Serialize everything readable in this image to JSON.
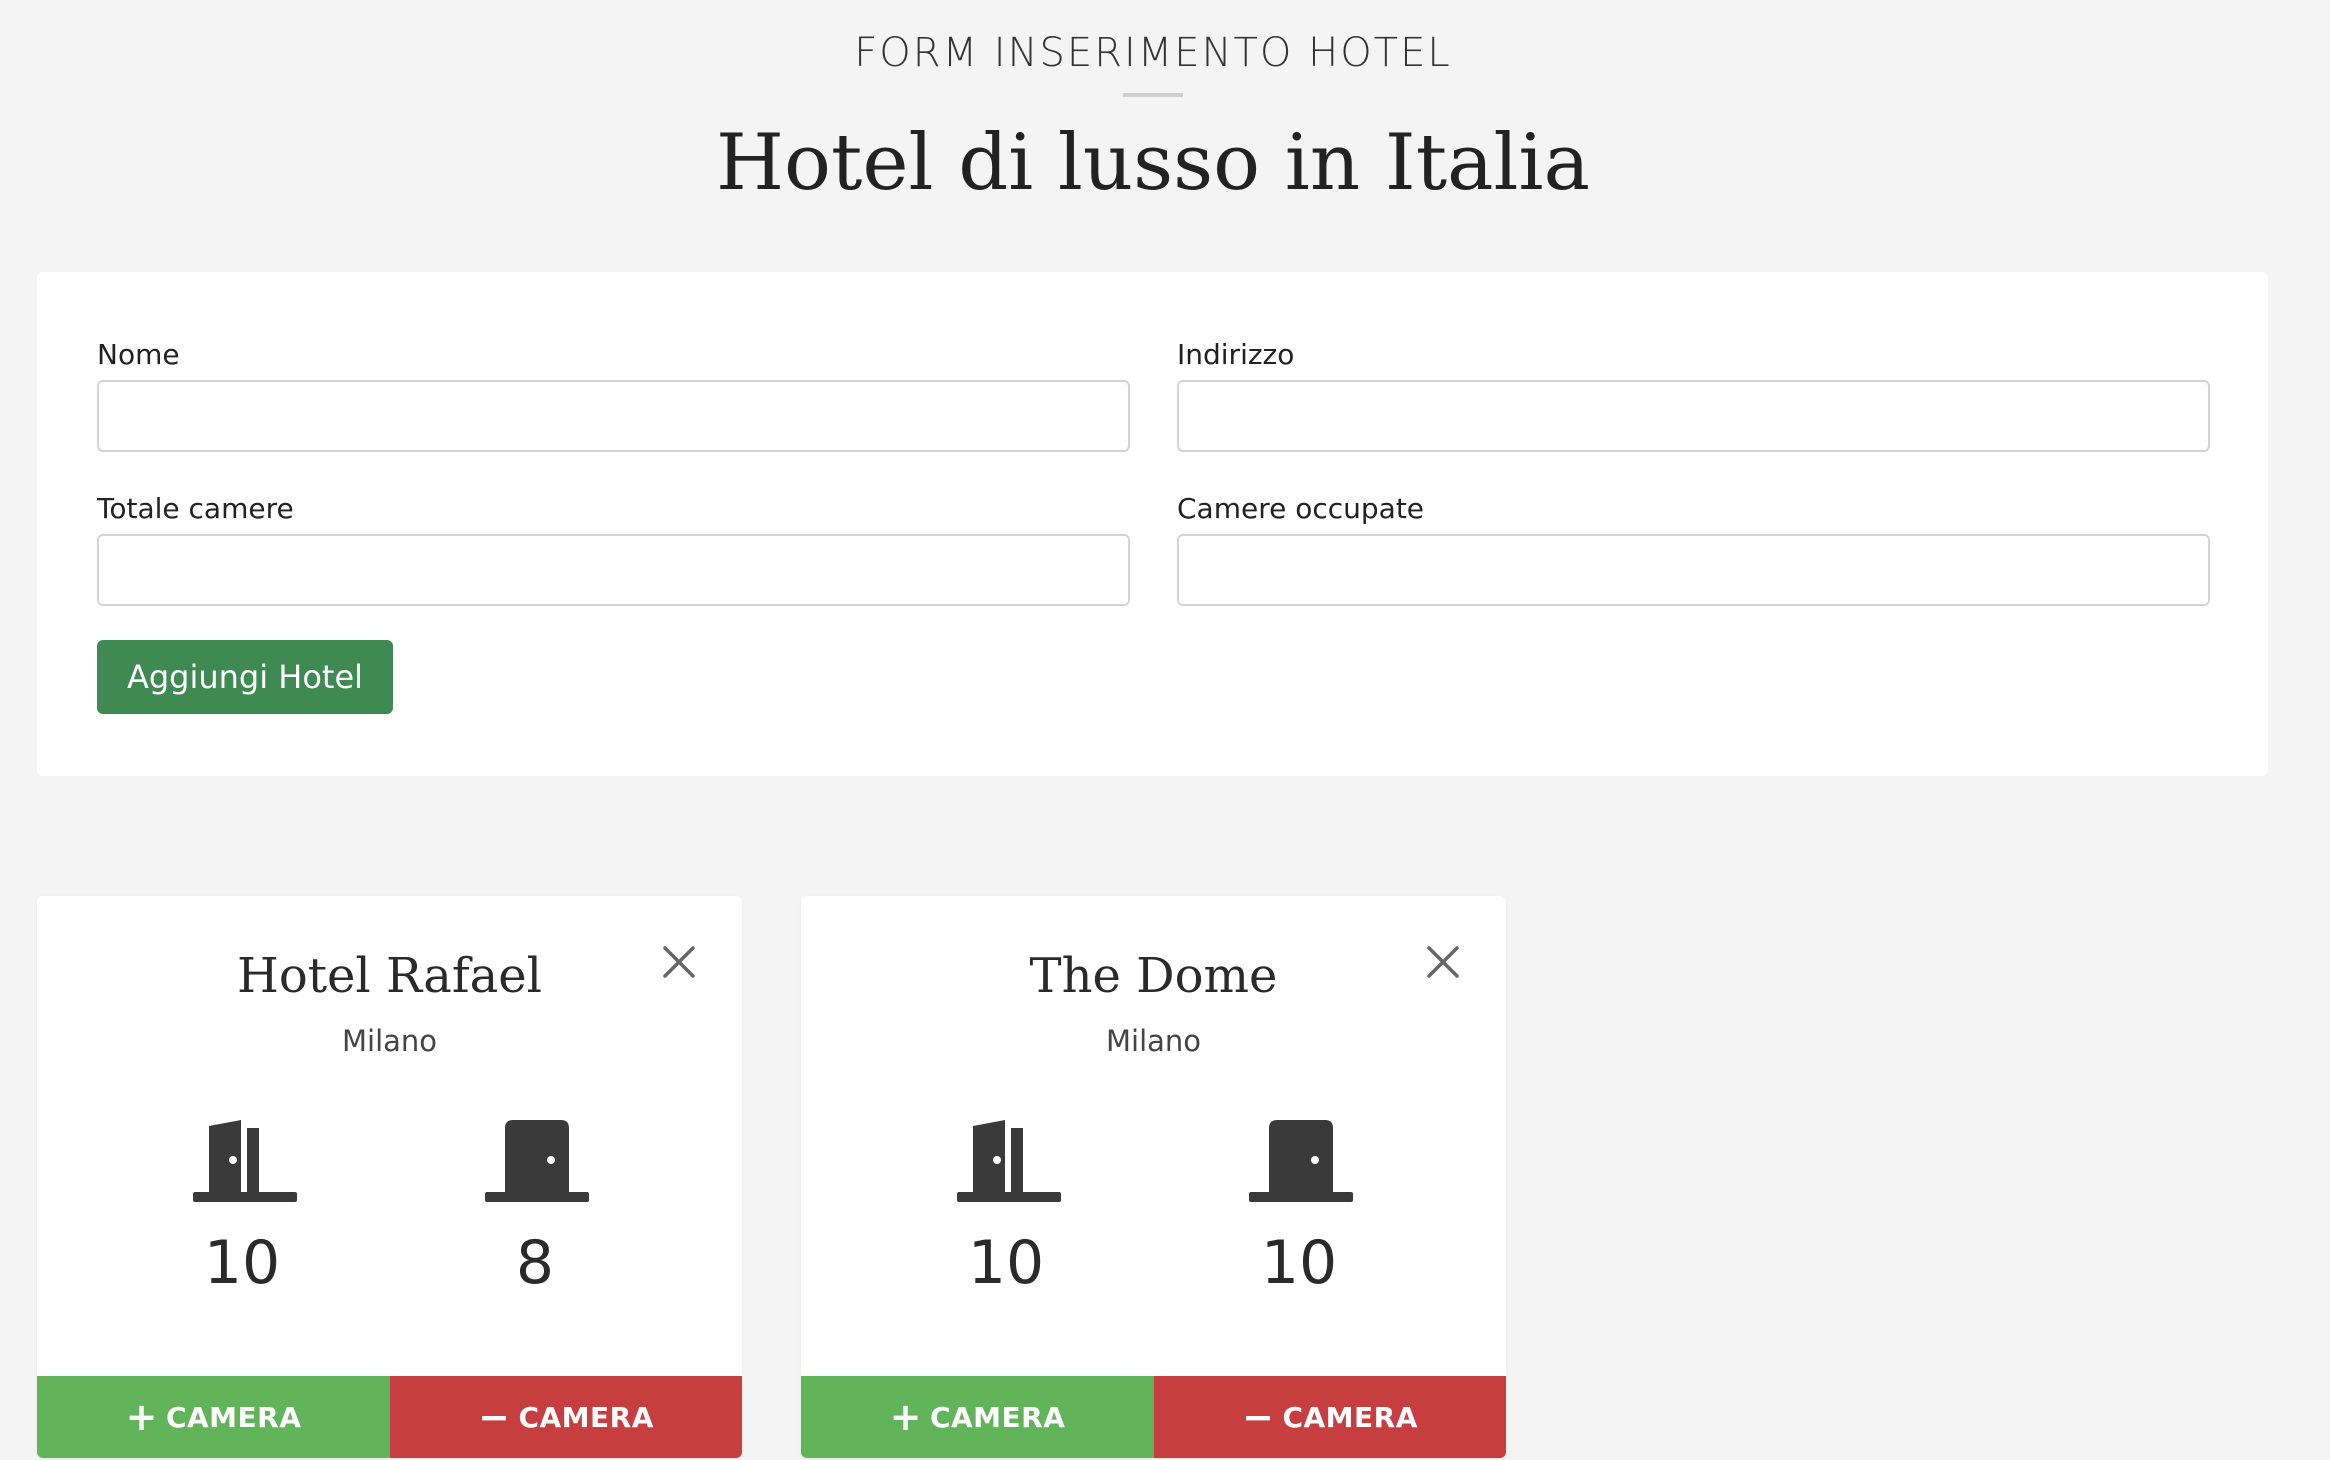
{
  "header": {
    "eyebrow": "FORM INSERIMENTO HOTEL",
    "title": "Hotel di lusso in Italia"
  },
  "form": {
    "fields": [
      {
        "label": "Nome",
        "value": "",
        "placeholder": ""
      },
      {
        "label": "Indirizzo",
        "value": "",
        "placeholder": ""
      },
      {
        "label": "Totale camere",
        "value": "",
        "placeholder": ""
      },
      {
        "label": "Camere occupate",
        "value": "",
        "placeholder": ""
      }
    ],
    "submit_label": "Aggiungi Hotel"
  },
  "hotels": [
    {
      "name": "Hotel Rafael",
      "city": "Milano",
      "total_rooms": "10",
      "occupied_rooms": "8",
      "add_label": "CAMERA",
      "remove_label": "CAMERA"
    },
    {
      "name": "The Dome",
      "city": "Milano",
      "total_rooms": "10",
      "occupied_rooms": "10",
      "add_label": "CAMERA",
      "remove_label": "CAMERA"
    }
  ],
  "icons": {
    "total_rooms": "door-open-icon",
    "occupied_rooms": "door-closed-icon",
    "remove_hotel": "close-icon",
    "add": "plus-icon",
    "remove": "minus-icon"
  },
  "colors": {
    "add_button": "#3e8a52",
    "camera_plus": "#62b45a",
    "camera_minus": "#c63e3f",
    "icon": "#3a3a3a"
  }
}
